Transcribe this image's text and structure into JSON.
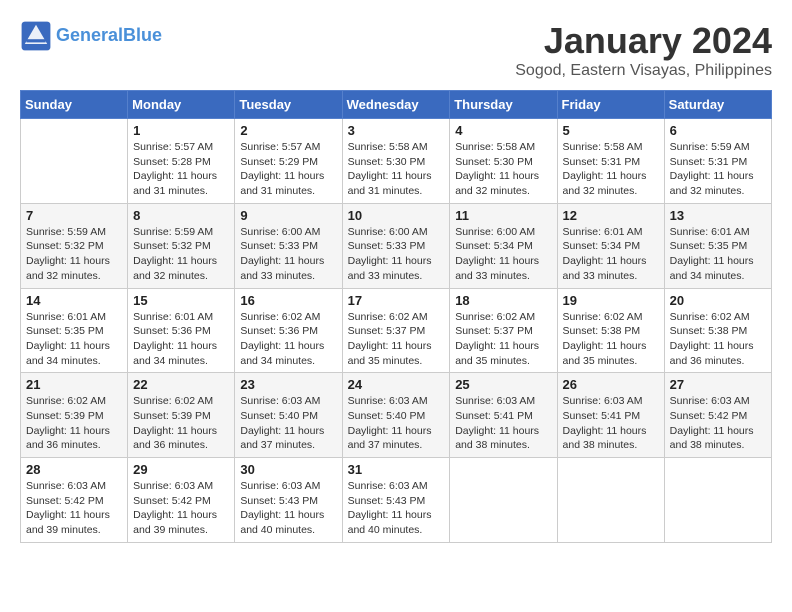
{
  "header": {
    "logo_line1": "General",
    "logo_line2": "Blue",
    "month": "January 2024",
    "location": "Sogod, Eastern Visayas, Philippines"
  },
  "days_of_week": [
    "Sunday",
    "Monday",
    "Tuesday",
    "Wednesday",
    "Thursday",
    "Friday",
    "Saturday"
  ],
  "weeks": [
    [
      {
        "num": "",
        "info": ""
      },
      {
        "num": "1",
        "info": "Sunrise: 5:57 AM\nSunset: 5:28 PM\nDaylight: 11 hours\nand 31 minutes."
      },
      {
        "num": "2",
        "info": "Sunrise: 5:57 AM\nSunset: 5:29 PM\nDaylight: 11 hours\nand 31 minutes."
      },
      {
        "num": "3",
        "info": "Sunrise: 5:58 AM\nSunset: 5:30 PM\nDaylight: 11 hours\nand 31 minutes."
      },
      {
        "num": "4",
        "info": "Sunrise: 5:58 AM\nSunset: 5:30 PM\nDaylight: 11 hours\nand 32 minutes."
      },
      {
        "num": "5",
        "info": "Sunrise: 5:58 AM\nSunset: 5:31 PM\nDaylight: 11 hours\nand 32 minutes."
      },
      {
        "num": "6",
        "info": "Sunrise: 5:59 AM\nSunset: 5:31 PM\nDaylight: 11 hours\nand 32 minutes."
      }
    ],
    [
      {
        "num": "7",
        "info": "Sunrise: 5:59 AM\nSunset: 5:32 PM\nDaylight: 11 hours\nand 32 minutes."
      },
      {
        "num": "8",
        "info": "Sunrise: 5:59 AM\nSunset: 5:32 PM\nDaylight: 11 hours\nand 32 minutes."
      },
      {
        "num": "9",
        "info": "Sunrise: 6:00 AM\nSunset: 5:33 PM\nDaylight: 11 hours\nand 33 minutes."
      },
      {
        "num": "10",
        "info": "Sunrise: 6:00 AM\nSunset: 5:33 PM\nDaylight: 11 hours\nand 33 minutes."
      },
      {
        "num": "11",
        "info": "Sunrise: 6:00 AM\nSunset: 5:34 PM\nDaylight: 11 hours\nand 33 minutes."
      },
      {
        "num": "12",
        "info": "Sunrise: 6:01 AM\nSunset: 5:34 PM\nDaylight: 11 hours\nand 33 minutes."
      },
      {
        "num": "13",
        "info": "Sunrise: 6:01 AM\nSunset: 5:35 PM\nDaylight: 11 hours\nand 34 minutes."
      }
    ],
    [
      {
        "num": "14",
        "info": "Sunrise: 6:01 AM\nSunset: 5:35 PM\nDaylight: 11 hours\nand 34 minutes."
      },
      {
        "num": "15",
        "info": "Sunrise: 6:01 AM\nSunset: 5:36 PM\nDaylight: 11 hours\nand 34 minutes."
      },
      {
        "num": "16",
        "info": "Sunrise: 6:02 AM\nSunset: 5:36 PM\nDaylight: 11 hours\nand 34 minutes."
      },
      {
        "num": "17",
        "info": "Sunrise: 6:02 AM\nSunset: 5:37 PM\nDaylight: 11 hours\nand 35 minutes."
      },
      {
        "num": "18",
        "info": "Sunrise: 6:02 AM\nSunset: 5:37 PM\nDaylight: 11 hours\nand 35 minutes."
      },
      {
        "num": "19",
        "info": "Sunrise: 6:02 AM\nSunset: 5:38 PM\nDaylight: 11 hours\nand 35 minutes."
      },
      {
        "num": "20",
        "info": "Sunrise: 6:02 AM\nSunset: 5:38 PM\nDaylight: 11 hours\nand 36 minutes."
      }
    ],
    [
      {
        "num": "21",
        "info": "Sunrise: 6:02 AM\nSunset: 5:39 PM\nDaylight: 11 hours\nand 36 minutes."
      },
      {
        "num": "22",
        "info": "Sunrise: 6:02 AM\nSunset: 5:39 PM\nDaylight: 11 hours\nand 36 minutes."
      },
      {
        "num": "23",
        "info": "Sunrise: 6:03 AM\nSunset: 5:40 PM\nDaylight: 11 hours\nand 37 minutes."
      },
      {
        "num": "24",
        "info": "Sunrise: 6:03 AM\nSunset: 5:40 PM\nDaylight: 11 hours\nand 37 minutes."
      },
      {
        "num": "25",
        "info": "Sunrise: 6:03 AM\nSunset: 5:41 PM\nDaylight: 11 hours\nand 38 minutes."
      },
      {
        "num": "26",
        "info": "Sunrise: 6:03 AM\nSunset: 5:41 PM\nDaylight: 11 hours\nand 38 minutes."
      },
      {
        "num": "27",
        "info": "Sunrise: 6:03 AM\nSunset: 5:42 PM\nDaylight: 11 hours\nand 38 minutes."
      }
    ],
    [
      {
        "num": "28",
        "info": "Sunrise: 6:03 AM\nSunset: 5:42 PM\nDaylight: 11 hours\nand 39 minutes."
      },
      {
        "num": "29",
        "info": "Sunrise: 6:03 AM\nSunset: 5:42 PM\nDaylight: 11 hours\nand 39 minutes."
      },
      {
        "num": "30",
        "info": "Sunrise: 6:03 AM\nSunset: 5:43 PM\nDaylight: 11 hours\nand 40 minutes."
      },
      {
        "num": "31",
        "info": "Sunrise: 6:03 AM\nSunset: 5:43 PM\nDaylight: 11 hours\nand 40 minutes."
      },
      {
        "num": "",
        "info": ""
      },
      {
        "num": "",
        "info": ""
      },
      {
        "num": "",
        "info": ""
      }
    ]
  ]
}
